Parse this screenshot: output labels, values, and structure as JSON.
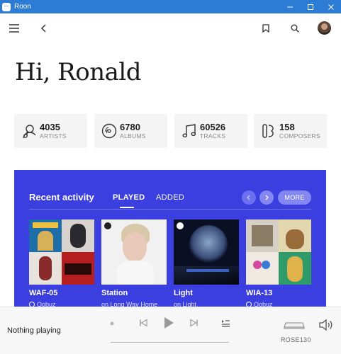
{
  "window": {
    "title": "Roon"
  },
  "greeting": "Hi, Ronald",
  "stats": [
    {
      "value": "4035",
      "label": "ARTISTS",
      "icon": "artist-icon"
    },
    {
      "value": "6780",
      "label": "ALBUMS",
      "icon": "album-icon"
    },
    {
      "value": "60526",
      "label": "TRACKS",
      "icon": "music-note-icon"
    },
    {
      "value": "158",
      "label": "COMPOSERS",
      "icon": "composer-icon"
    }
  ],
  "recent": {
    "title": "Recent activity",
    "tabs": [
      {
        "label": "PLAYED",
        "active": true
      },
      {
        "label": "ADDED",
        "active": false
      }
    ],
    "more_label": "MORE",
    "cards": [
      {
        "title": "WAF-05",
        "subtitle": "Qobuz"
      },
      {
        "title": "Station",
        "subtitle": "on Long Way Home"
      },
      {
        "title": "Light",
        "subtitle": "on Light"
      },
      {
        "title": "WIA-13",
        "subtitle": "Qobuz"
      }
    ]
  },
  "player": {
    "status": "Nothing playing",
    "zone": "ROSE130"
  },
  "colors": {
    "titlebar": "#2c7bd4",
    "panel": "#3b3fe0",
    "stat_bg": "#f4f4f5"
  }
}
